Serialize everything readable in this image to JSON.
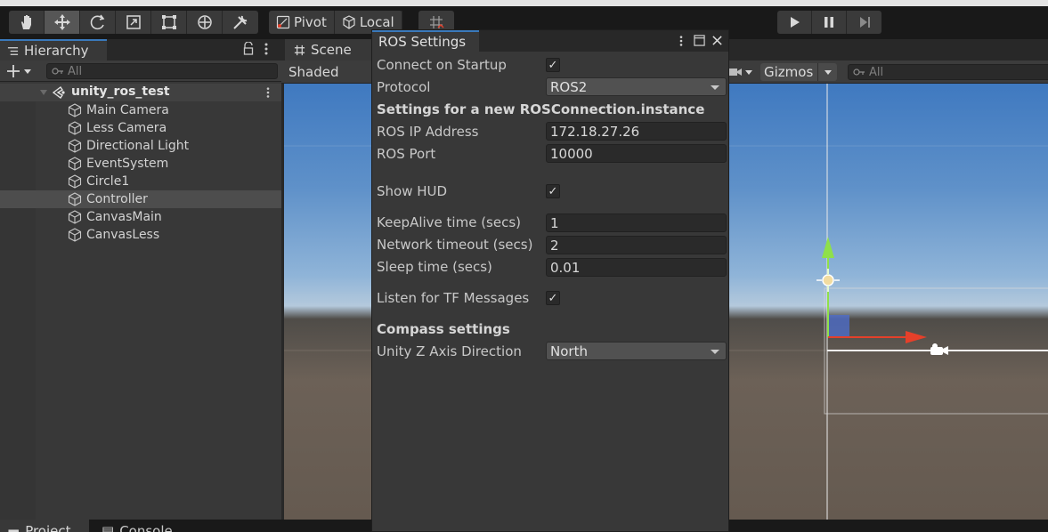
{
  "toolbar": {
    "pivot_label": "Pivot",
    "local_label": "Local"
  },
  "hierarchy": {
    "tab_label": "Hierarchy",
    "search_placeholder": "All",
    "scene_name": "unity_ros_test",
    "items": [
      {
        "label": "Main Camera"
      },
      {
        "label": "Less Camera"
      },
      {
        "label": "Directional Light"
      },
      {
        "label": "EventSystem"
      },
      {
        "label": "Circle1"
      },
      {
        "label": "Controller",
        "selected": true
      },
      {
        "label": "CanvasMain"
      },
      {
        "label": "CanvasLess"
      }
    ]
  },
  "scene": {
    "tab_label": "Scene",
    "shading_label": "Shaded",
    "gizmos_label": "Gizmos",
    "search_placeholder": "All"
  },
  "ros_settings": {
    "title": "ROS Settings",
    "connect_on_startup_label": "Connect on Startup",
    "connect_on_startup": true,
    "protocol_label": "Protocol",
    "protocol_value": "ROS2",
    "section_new_connection": "Settings for a new ROSConnection.instance",
    "ip_label": "ROS IP Address",
    "ip_value": "172.18.27.26",
    "port_label": "ROS Port",
    "port_value": "10000",
    "show_hud_label": "Show HUD",
    "show_hud": true,
    "keepalive_label": "KeepAlive time (secs)",
    "keepalive_value": "1",
    "network_timeout_label": "Network timeout (secs)",
    "network_timeout_value": "2",
    "sleep_label": "Sleep time (secs)",
    "sleep_value": "0.01",
    "listen_tf_label": "Listen for TF Messages",
    "listen_tf": true,
    "section_compass": "Compass settings",
    "z_axis_label": "Unity Z Axis Direction",
    "z_axis_value": "North",
    "check_glyph": "✓"
  },
  "bottom_tabs": {
    "project_label": "Project",
    "console_label": "Console"
  },
  "colors": {
    "accent": "#3a79bb",
    "panel": "#383838",
    "gizmo_y": "#8fe04a",
    "gizmo_x": "#e5402a"
  }
}
